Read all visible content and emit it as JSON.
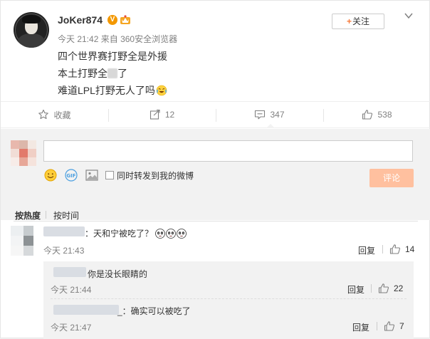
{
  "post": {
    "username": "JoKer874",
    "verified_badge": "V",
    "time": "今天 21:42",
    "via": "来自",
    "source": "360安全浏览器",
    "follow_label": "关注",
    "lines": [
      "四个世界赛打野全是外援",
      "本土打野全",
      "了",
      "难道LPL打野无人了吗"
    ]
  },
  "actions": {
    "collect_label": "收藏",
    "repost_count": "12",
    "comment_count": "347",
    "like_count": "538"
  },
  "composer": {
    "placeholder": "",
    "repost_checkbox_label": "同时转发到我的微博",
    "submit_label": "评论"
  },
  "sort": {
    "hot_label": "按热度",
    "time_label": "按时间"
  },
  "comments": [
    {
      "text": "：天和宁被吃了？",
      "time": "今天 21:43",
      "reply_label": "回复",
      "likes": "14",
      "replies": [
        {
          "text": "你是没长眼睛的",
          "time": "今天 21:44",
          "reply_label": "回复",
          "likes": "22"
        },
        {
          "text": "_：确实可以被吃了",
          "time": "今天 21:47",
          "reply_label": "回复",
          "likes": "7"
        }
      ]
    }
  ],
  "colors": {
    "accent": "#f77c3d",
    "submit_disabled": "#ffc09f",
    "verified": "#f39800",
    "muted_text": "#808080"
  }
}
